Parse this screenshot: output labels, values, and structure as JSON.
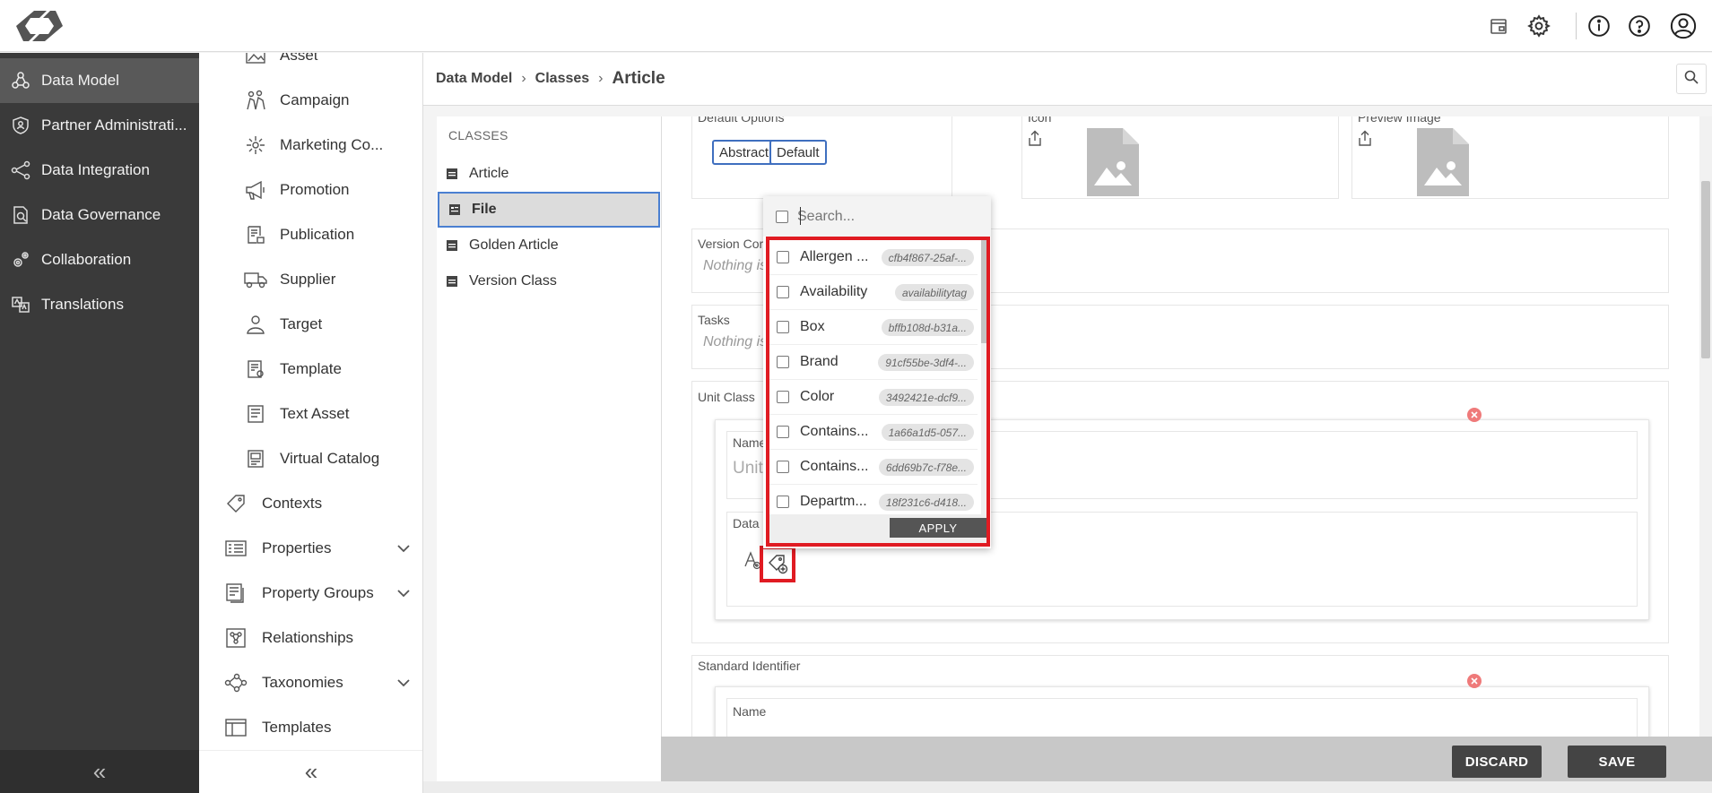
{
  "leftnav": {
    "items": [
      {
        "label": "Data Model",
        "icon": "data-model-icon",
        "active": true
      },
      {
        "label": "Partner Administrati...",
        "icon": "partner-shield-icon"
      },
      {
        "label": "Data Integration",
        "icon": "integration-nodes-icon"
      },
      {
        "label": "Data Governance",
        "icon": "governance-icon"
      },
      {
        "label": "Collaboration",
        "icon": "collaboration-gear-icon"
      },
      {
        "label": "Translations",
        "icon": "translations-icon"
      }
    ],
    "collapse_glyph": "«"
  },
  "subnav": {
    "items": [
      {
        "label": "Asset",
        "icon": "asset-icon"
      },
      {
        "label": "Campaign",
        "icon": "campaign-icon"
      },
      {
        "label": "Marketing Co...",
        "icon": "marketing-icon"
      },
      {
        "label": "Promotion",
        "icon": "megaphone-icon"
      },
      {
        "label": "Publication",
        "icon": "publication-icon"
      },
      {
        "label": "Supplier",
        "icon": "truck-icon"
      },
      {
        "label": "Target",
        "icon": "target-icon"
      },
      {
        "label": "Template",
        "icon": "template-icon"
      },
      {
        "label": "Text Asset",
        "icon": "text-asset-icon"
      },
      {
        "label": "Virtual Catalog",
        "icon": "virtual-catalog-icon"
      },
      {
        "label": "Contexts",
        "icon": "tag-icon"
      },
      {
        "label": "Properties",
        "icon": "properties-icon",
        "expandable": true
      },
      {
        "label": "Property Groups",
        "icon": "property-groups-icon",
        "expandable": true
      },
      {
        "label": "Relationships",
        "icon": "relationships-icon"
      },
      {
        "label": "Taxonomies",
        "icon": "taxonomies-icon",
        "expandable": true
      },
      {
        "label": "Templates",
        "icon": "templates-icon"
      }
    ],
    "collapse_glyph": "«"
  },
  "breadcrumb": {
    "items": [
      "Data Model",
      "Classes"
    ],
    "current": "Article",
    "separator": "›"
  },
  "classes": {
    "title": "CLASSES",
    "items": [
      {
        "label": "Article"
      },
      {
        "label": "File",
        "selected": true
      },
      {
        "label": "Golden Article"
      },
      {
        "label": "Version Class"
      }
    ]
  },
  "detail": {
    "default_options_label": "Default Options",
    "chips": [
      "Abstract",
      "Default"
    ],
    "icon_label": "Icon",
    "preview_label": "Preview Image",
    "version_label": "Version Cor",
    "version_empty": "Nothing is",
    "tasks_label": "Tasks",
    "tasks_empty": "Nothing is",
    "unit_class_label": "Unit Class",
    "unit_name_label": "Name",
    "unit_name_value": "Unit",
    "data_label": "Data",
    "standard_identifier_label": "Standard Identifier",
    "std_name_label": "Name"
  },
  "popup": {
    "search_placeholder": "Search...",
    "options": [
      {
        "label": "Allergen ...",
        "tag": "cfb4f867-25af-..."
      },
      {
        "label": "Availability",
        "tag": "availabilitytag"
      },
      {
        "label": "Box",
        "tag": "bffb108d-b31a..."
      },
      {
        "label": "Brand",
        "tag": "91cf55be-3df4-..."
      },
      {
        "label": "Color",
        "tag": "3492421e-dcf9..."
      },
      {
        "label": "Contains...",
        "tag": "1a66a1d5-057..."
      },
      {
        "label": "Contains...",
        "tag": "6dd69b7c-f78e..."
      },
      {
        "label": "Departm...",
        "tag": "18f231c6-d418..."
      }
    ],
    "apply_label": "APPLY"
  },
  "footer": {
    "discard_label": "DISCARD",
    "save_label": "SAVE"
  },
  "colors": {
    "nav_bg": "#3a3a3a",
    "nav_active": "#595959",
    "selection_border": "#4a7fd1",
    "highlight_red": "#e01b22",
    "button_dark": "#444444"
  }
}
